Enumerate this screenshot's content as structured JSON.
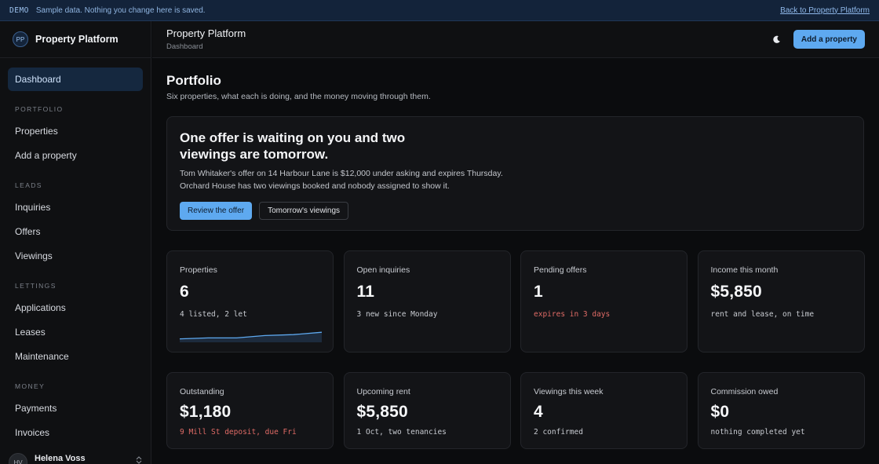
{
  "banner": {
    "tag": "DEMO",
    "message": "Sample data. Nothing you change here is saved.",
    "link": "Back to Property Platform"
  },
  "brand": {
    "initials": "PP",
    "name": "Property Platform"
  },
  "sidebar": {
    "active": "Dashboard",
    "sections": [
      {
        "title": "PORTFOLIO",
        "items": [
          "Properties",
          "Add a property"
        ]
      },
      {
        "title": "LEADS",
        "items": [
          "Inquiries",
          "Offers",
          "Viewings"
        ]
      },
      {
        "title": "LETTINGS",
        "items": [
          "Applications",
          "Leases",
          "Maintenance"
        ]
      },
      {
        "title": "MONEY",
        "items": [
          "Payments",
          "Invoices"
        ]
      }
    ],
    "user": {
      "initials": "HV",
      "name": "Helena Voss"
    }
  },
  "header": {
    "title": "Property Platform",
    "subtitle": "Dashboard",
    "add_button": "Add a property",
    "theme_icon": "moon-icon"
  },
  "page": {
    "title": "Portfolio",
    "subtitle": "Six properties, what each is doing, and the money moving through them."
  },
  "hero": {
    "title": "One offer is waiting on you and two viewings are tomorrow.",
    "line1": "Tom Whitaker's offer on 14 Harbour Lane is $12,000 under asking and expires Thursday.",
    "line2": "Orchard House has two viewings booked and nobody assigned to show it.",
    "primary": "Review the offer",
    "secondary": "Tomorrow's viewings"
  },
  "stats_row1": [
    {
      "label": "Properties",
      "value": "6",
      "note": "4 listed, 2 let",
      "alert": false,
      "sparkline": [
        0.2,
        0.3,
        0.3,
        0.55,
        0.65,
        0.9
      ]
    },
    {
      "label": "Open inquiries",
      "value": "11",
      "note": "3 new since Monday",
      "alert": false
    },
    {
      "label": "Pending offers",
      "value": "1",
      "note": "expires in 3 days",
      "alert": true
    },
    {
      "label": "Income this month",
      "value": "$5,850",
      "note": "rent and lease, on time",
      "alert": false
    }
  ],
  "stats_row2": [
    {
      "label": "Outstanding",
      "value": "$1,180",
      "note": "9 Mill St deposit, due Fri",
      "alert": true
    },
    {
      "label": "Upcoming rent",
      "value": "$5,850",
      "note": "1 Oct, two tenancies",
      "alert": false
    },
    {
      "label": "Viewings this week",
      "value": "4",
      "note": "2 confirmed",
      "alert": false
    },
    {
      "label": "Commission owed",
      "value": "$0",
      "note": "nothing completed yet",
      "alert": false
    }
  ],
  "colors": {
    "accent": "#5ea9f0",
    "alert": "#e06b66",
    "banner_bg": "#13233a"
  }
}
